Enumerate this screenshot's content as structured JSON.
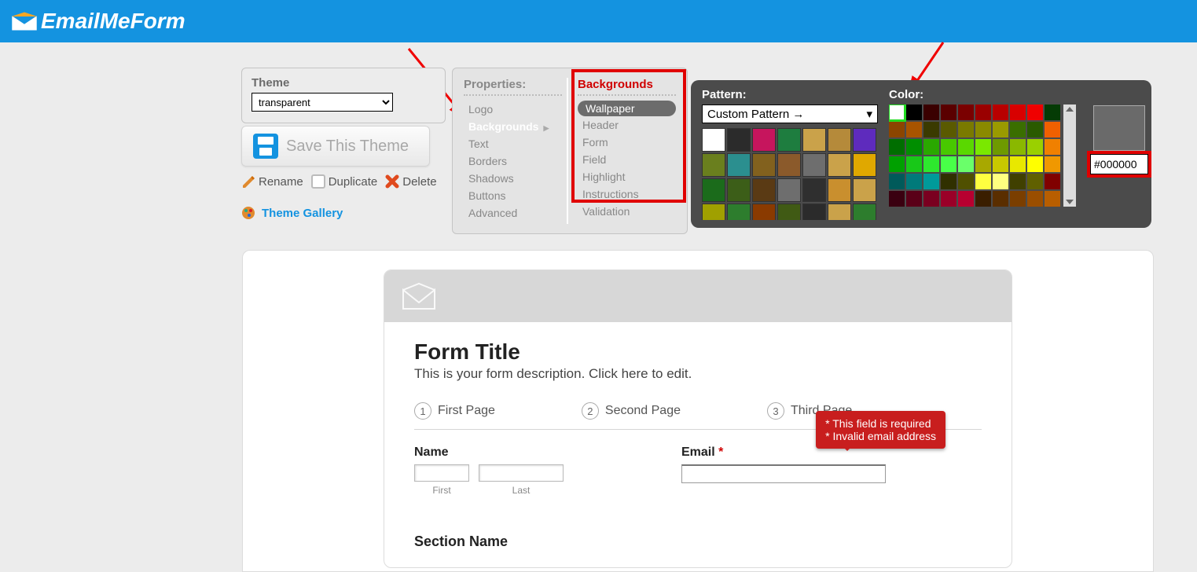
{
  "brand": "EmailMeForm",
  "theme_label": "Theme",
  "theme_value": "transparent",
  "save_label": "Save This Theme",
  "tools": {
    "rename": "Rename",
    "duplicate": "Duplicate",
    "delete": "Delete"
  },
  "gallery": "Theme Gallery",
  "properties": {
    "head": "Properties:",
    "items": [
      "Logo",
      "Backgrounds",
      "Text",
      "Borders",
      "Shadows",
      "Buttons",
      "Advanced"
    ],
    "active": "Backgrounds"
  },
  "backgrounds": {
    "head": "Backgrounds",
    "items": [
      "Wallpaper",
      "Header",
      "Form",
      "Field",
      "Highlight",
      "Instructions",
      "Validation"
    ],
    "active": "Wallpaper"
  },
  "palette": {
    "pattern_label": "Pattern:",
    "pattern_value": "Custom Pattern →",
    "color_label": "Color:",
    "hex": "#000000",
    "pattern_colors": [
      "#ffffff",
      "#2b2b2b",
      "#c6155d",
      "#1e7d3f",
      "#caa24a",
      "#b58a3a",
      "#5e2bbd",
      "#6a7f1e",
      "#2b8f8f",
      "#82611e",
      "#8b5a2b",
      "#6e6e6e",
      "#caa24a",
      "#e0a800",
      "#1b6b1b",
      "#3c5e18",
      "#5a3a14",
      "#6e6e6e",
      "#2f2f2f",
      "#c98f2e",
      "#caa24a",
      "#a0a000",
      "#2d7d2d",
      "#8a3a00",
      "#405a14",
      "#2b2b2b",
      "#caa24a",
      "#2d7d2d"
    ],
    "color_swatches": [
      "#ffffff",
      "#000000",
      "#3a0000",
      "#5a0000",
      "#7a0000",
      "#9a0000",
      "#b80000",
      "#d80000",
      "#f00000",
      "#053b05",
      "#8b4500",
      "#a85400",
      "#3a3a00",
      "#5a5a00",
      "#7a7a00",
      "#8a8a00",
      "#9a9a00",
      "#3a6e00",
      "#2a5a00",
      "#f06000",
      "#006e00",
      "#008e00",
      "#2aa800",
      "#48c800",
      "#5ad800",
      "#7ae800",
      "#6e9a00",
      "#8ab800",
      "#9ad000",
      "#f08000",
      "#00a000",
      "#18c818",
      "#2ee82e",
      "#48ff48",
      "#6aff6a",
      "#a8a800",
      "#c8c800",
      "#e8e800",
      "#ffff00",
      "#f09800",
      "#005a5a",
      "#007a7a",
      "#009a9a",
      "#303000",
      "#505000",
      "#ffff40",
      "#ffff80",
      "#404000",
      "#606000",
      "#800000",
      "#3a0010",
      "#5a0018",
      "#7a0020",
      "#9a0028",
      "#b80030",
      "#3a1e00",
      "#5a2e00",
      "#7a3e00",
      "#9a4e00",
      "#b85e00"
    ]
  },
  "form": {
    "title": "Form Title",
    "desc": "This is your form description. Click here to edit.",
    "pages": [
      "First Page",
      "Second Page",
      "Third Page"
    ],
    "name_label": "Name",
    "first": "First",
    "last": "Last",
    "email_label": "Email",
    "err1": "* This field is required",
    "err2": "* Invalid email address",
    "section": "Section Name"
  }
}
